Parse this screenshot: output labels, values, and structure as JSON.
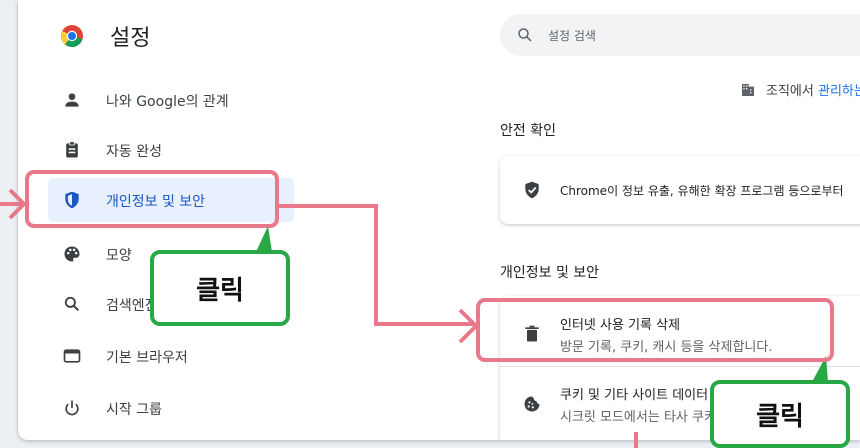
{
  "app": {
    "title": "설정",
    "logo_icon": "chrome-logo-icon"
  },
  "search": {
    "placeholder": "설정 검색",
    "icon": "search-icon"
  },
  "sidebar": {
    "items": [
      {
        "label": "나와 Google의 관계",
        "icon": "person-icon"
      },
      {
        "label": "자동 완성",
        "icon": "clipboard-icon"
      },
      {
        "label": "개인정보 및 보안",
        "icon": "shield-icon",
        "active": true
      },
      {
        "label": "모양",
        "icon": "palette-icon"
      },
      {
        "label": "검색엔진",
        "icon": "search-icon"
      },
      {
        "label": "기본 브라우저",
        "icon": "browser-icon"
      },
      {
        "label": "시작 그룹",
        "icon": "power-icon"
      }
    ]
  },
  "managed": {
    "prefix": "조직에서",
    "link": "관리하는",
    "icon": "building-icon"
  },
  "safety_check": {
    "title": "안전 확인",
    "text": "Chrome이 정보 유출, 유해한 확장 프로그램 등으로부터",
    "icon": "shield-check-icon"
  },
  "privacy": {
    "title": "개인정보 및 보안",
    "items": [
      {
        "title": "인터넷 사용 기록 삭제",
        "subtitle": "방문 기록, 쿠키, 캐시 등을 삭제합니다.",
        "icon": "trash-icon"
      },
      {
        "title": "쿠키 및 기타 사이트 데이터",
        "subtitle": "시크릿 모드에서는 타사 쿠키",
        "icon": "cookie-icon"
      }
    ]
  },
  "annotations": {
    "click_label_1": "클릭",
    "click_label_2": "클릭",
    "highlight_color": "#e8798a",
    "callout_color": "#27a844"
  }
}
